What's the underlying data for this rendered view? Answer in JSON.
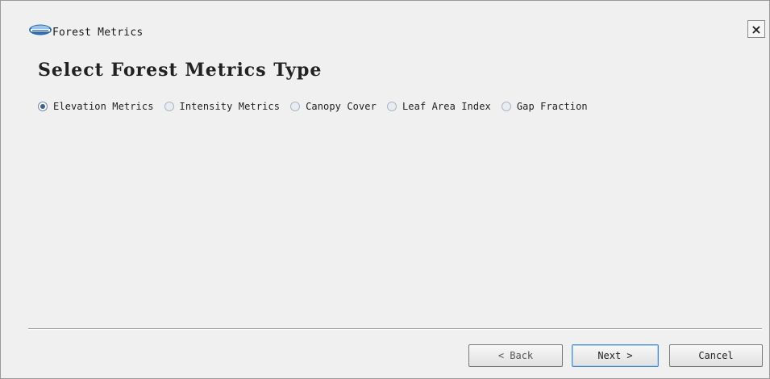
{
  "window": {
    "title": "Forest Metrics",
    "close_label": "×"
  },
  "heading": "Select Forest Metrics Type",
  "metrics_options": [
    {
      "label": "Elevation Metrics",
      "checked": true
    },
    {
      "label": "Intensity Metrics",
      "checked": false
    },
    {
      "label": "Canopy Cover",
      "checked": false
    },
    {
      "label": "Leaf Area Index",
      "checked": false
    },
    {
      "label": "Gap Fraction",
      "checked": false
    }
  ],
  "buttons": {
    "back": "< Back",
    "next": "Next >",
    "cancel": "Cancel"
  },
  "icons": {
    "app": "app-logo-icon",
    "close": "close-icon"
  },
  "colors": {
    "dialog_bg": "#f0f0f0",
    "radio_selected": "#3a5f8e",
    "default_button_border": "#4c8bd0"
  }
}
